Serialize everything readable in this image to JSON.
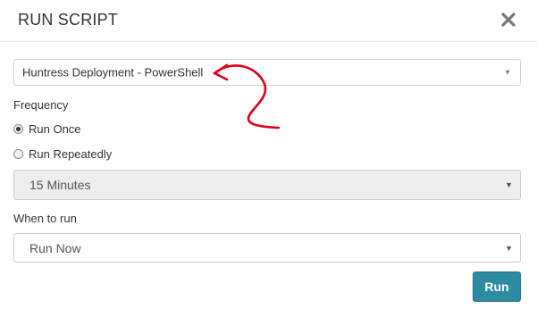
{
  "dialog": {
    "title": "RUN SCRIPT",
    "close_icon": "close-icon"
  },
  "script_select": {
    "value": "Huntress Deployment - PowerShell",
    "caret_icon": "caret-down-icon"
  },
  "frequency": {
    "label": "Frequency",
    "options": [
      {
        "label": "Run Once",
        "checked": true
      },
      {
        "label": "Run Repeatedly",
        "checked": false
      }
    ],
    "interval_select": {
      "value": "15 Minutes",
      "disabled": true
    }
  },
  "when_to_run": {
    "label": "When to run",
    "value": "Run Now"
  },
  "run_button": {
    "label": "Run",
    "color": "#2b8ba0"
  },
  "annotation": {
    "icon": "red-arrow-annotation",
    "color": "#e0001b"
  }
}
